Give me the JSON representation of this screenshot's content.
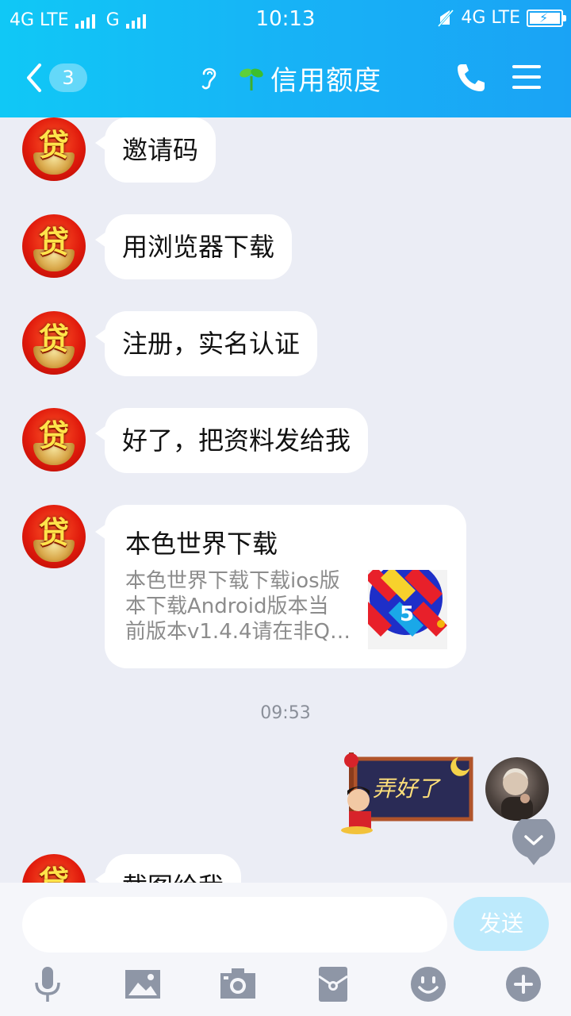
{
  "status_bar": {
    "left_network": "4G LTE",
    "left_carrier2": "G",
    "time": "10:13",
    "right_network": "4G LTE"
  },
  "header": {
    "back_count": "3",
    "title": "信用额度",
    "accent_color": "#17b3f6"
  },
  "messages": [
    {
      "sender": "other",
      "text": "邀请码"
    },
    {
      "sender": "other",
      "text": "用浏览器下载"
    },
    {
      "sender": "other",
      "text": "注册，实名认证"
    },
    {
      "sender": "other",
      "text": "好了，把资料发给我"
    }
  ],
  "link_card": {
    "title": "本色世界下载",
    "desc_lines": [
      "本色世界下载下载ios版",
      "本下载Android版本当",
      "前版本v1.4.4请在非Q…"
    ]
  },
  "timestamp": "09:53",
  "my_sticker": {
    "text": "弄好了"
  },
  "partial_message": {
    "text": "截图给我"
  },
  "other_avatar_glyph": "贷",
  "input": {
    "value": "",
    "send_label": "发送"
  },
  "toolbar_icons": [
    "microphone-icon",
    "image-icon",
    "camera-icon",
    "red-packet-icon",
    "emoji-icon",
    "plus-icon"
  ]
}
